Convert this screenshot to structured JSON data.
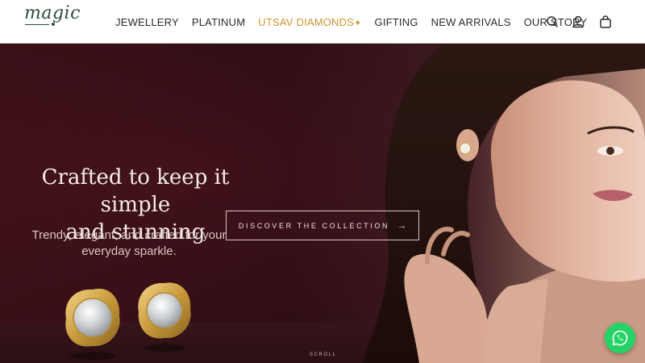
{
  "brand": {
    "logo_text": "magic"
  },
  "nav": {
    "items": [
      {
        "label": "JEWELLERY"
      },
      {
        "label": "PLATINUM"
      },
      {
        "label": "UTSAV DIAMONDS",
        "badge": "✦"
      },
      {
        "label": "GIFTING"
      },
      {
        "label": "NEW ARRIVALS"
      },
      {
        "label": "OUR STORY"
      }
    ],
    "icons": [
      "search-icon",
      "account-icon",
      "bag-icon"
    ]
  },
  "hero": {
    "headline_line1": "Crafted to keep it simple",
    "headline_line2": "and stunning",
    "subline_line1": "Trendy, elegant, and crafted for your",
    "subline_line2": "everyday sparkle.",
    "cta_label": "DISCOVER THE COLLECTION",
    "cta_arrow": "→",
    "scroll_label": "SCROLL"
  },
  "floating": {
    "whatsapp": "whatsapp-icon"
  },
  "colors": {
    "accent": "#c9962f",
    "brand_green": "#2f4d3b",
    "hero_bg": "#2f0d14",
    "whatsapp": "#25d366"
  }
}
